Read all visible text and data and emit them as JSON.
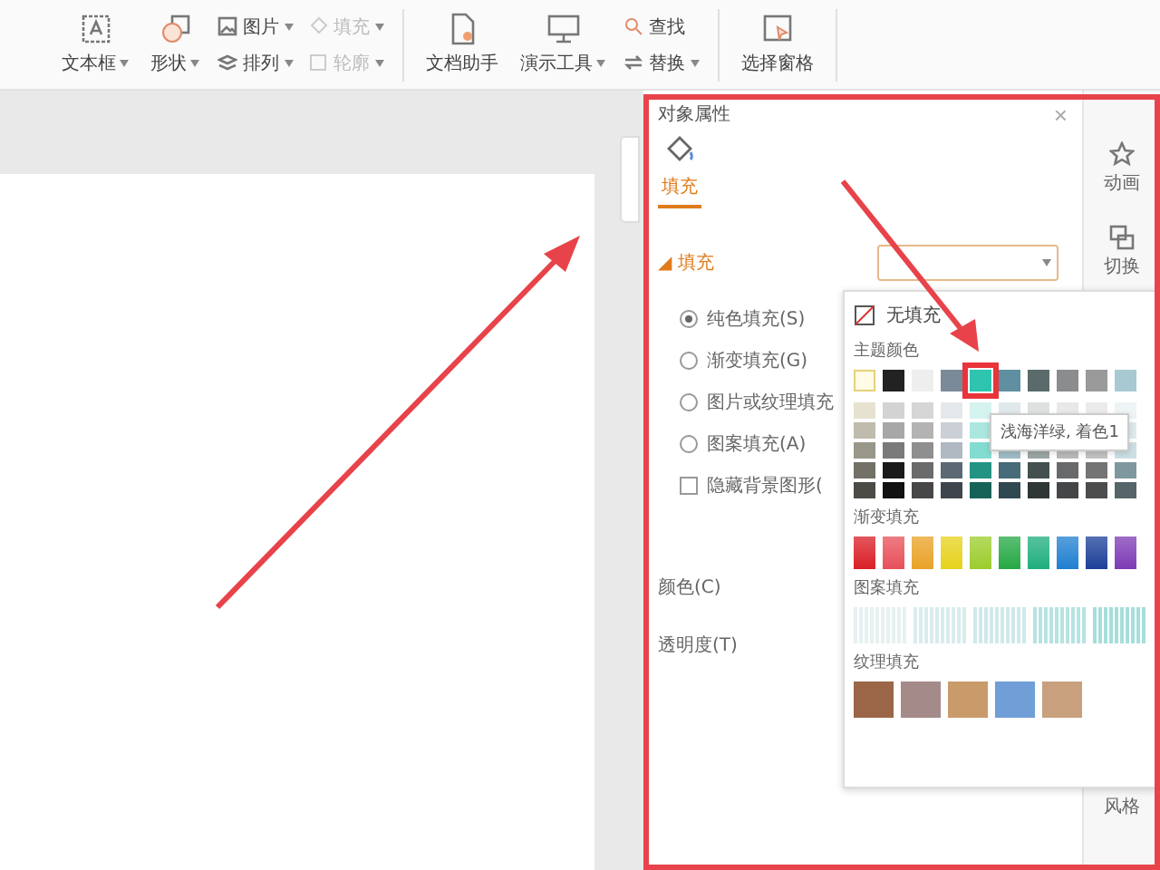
{
  "ribbon": {
    "groups": [
      {
        "items": [
          {
            "kind": "large",
            "label": "文本框",
            "has_menu": true
          },
          {
            "kind": "large",
            "label": "形状",
            "has_menu": true
          },
          {
            "kind": "stack",
            "items": [
              {
                "label": "图片",
                "has_menu": true,
                "disabled": false
              },
              {
                "label": "排列",
                "has_menu": true,
                "disabled": false
              }
            ]
          },
          {
            "kind": "stack",
            "items": [
              {
                "label": "填充",
                "has_menu": true,
                "disabled": true
              },
              {
                "label": "轮廓",
                "has_menu": true,
                "disabled": true
              }
            ]
          }
        ]
      },
      {
        "items": [
          {
            "kind": "large",
            "label": "文档助手",
            "has_menu": false
          },
          {
            "kind": "large",
            "label": "演示工具",
            "has_menu": true
          },
          {
            "kind": "stack",
            "items": [
              {
                "label": "查找",
                "has_menu": false,
                "disabled": false
              },
              {
                "label": "替换",
                "has_menu": true,
                "disabled": false
              }
            ]
          }
        ]
      },
      {
        "items": [
          {
            "kind": "large",
            "label": "选择窗格",
            "has_menu": false
          }
        ]
      }
    ]
  },
  "panel": {
    "title": "对象属性",
    "close": "×",
    "tabs": [
      {
        "label": "填充",
        "selected": true
      }
    ],
    "section": {
      "marker": "◢",
      "label": "填充"
    },
    "fill_options": [
      {
        "kind": "radio",
        "label": "纯色填充(S)",
        "selected": true
      },
      {
        "kind": "radio",
        "label": "渐变填充(G)",
        "selected": false
      },
      {
        "kind": "radio",
        "label": "图片或纹理填充",
        "selected": false
      },
      {
        "kind": "radio",
        "label": "图案填充(A)",
        "selected": false
      },
      {
        "kind": "checkbox",
        "label": "隐藏背景图形(",
        "checked": false
      }
    ],
    "fields": [
      {
        "label": "颜色(C)"
      },
      {
        "label": "透明度(T)"
      }
    ],
    "sidebar": [
      {
        "label": "动画"
      },
      {
        "label": "切换"
      },
      {
        "label": "风格"
      }
    ]
  },
  "color_picker": {
    "no_fill": "无填充",
    "theme_title": "主题颜色",
    "theme_colors": [
      {
        "color": "#fffbe6",
        "selected": false
      },
      {
        "color": "#222222",
        "selected": false
      },
      {
        "color": "#eeeeee",
        "selected": false
      },
      {
        "color": "#7b8a99",
        "selected": false
      },
      {
        "color": "#2ec4b0",
        "selected": true
      },
      {
        "color": "#5f8fa0",
        "selected": false
      },
      {
        "color": "#5b6b6b",
        "selected": false
      },
      {
        "color": "#8a8c8e",
        "selected": false
      },
      {
        "color": "#9a9a9a",
        "selected": false
      },
      {
        "color": "#a9c9d2",
        "selected": false
      }
    ],
    "tooltip": "浅海洋绿, 着色1",
    "gradient_title": "渐变填充",
    "gradients": [
      {
        "color": "#d91f26"
      },
      {
        "color": "#e8505a"
      },
      {
        "color": "#e9a227"
      },
      {
        "color": "#e6d21c"
      },
      {
        "color": "#9ccc2c"
      },
      {
        "color": "#25a844"
      },
      {
        "color": "#1fae7e"
      },
      {
        "color": "#1f7fd0"
      },
      {
        "color": "#1c3f98"
      },
      {
        "color": "#7d3bb5"
      }
    ],
    "pattern_title": "图案填充",
    "patterns": [
      {
        "color": "#e6f1f1"
      },
      {
        "color": "#d9ecec"
      },
      {
        "color": "#cfe9e9"
      },
      {
        "color": "#b7e3e1"
      },
      {
        "color": "#a6dedb"
      }
    ],
    "texture_title": "纹理填充",
    "textures": [
      {
        "color": "#9a6647"
      },
      {
        "color": "#a48a88"
      },
      {
        "color": "#c99a6a"
      },
      {
        "color": "#6f9fd6"
      },
      {
        "color": "#c8a07e"
      }
    ]
  }
}
